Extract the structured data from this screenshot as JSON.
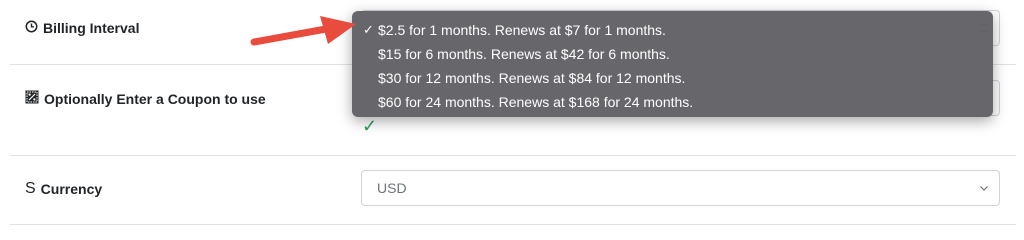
{
  "billing": {
    "label": "Billing Interval",
    "options": [
      "$2.5 for 1 months. Renews at $7 for 1 months.",
      "$15 for 6 months. Renews at $42 for 6 months.",
      "$30 for 12 months. Renews at $84 for 12 months.",
      "$60 for 24 months. Renews at $168 for 24 months."
    ],
    "selected_index": 0,
    "check_glyph": "✓"
  },
  "coupon": {
    "label": "Optionally Enter a Coupon to use",
    "valid_mark": "✓"
  },
  "currency": {
    "label": "Currency",
    "value": "USD",
    "icon_glyph": "S"
  },
  "colors": {
    "annotation_arrow": "#e94b3c",
    "valid_check": "#2e9e5b",
    "dropdown_bg": "#606065"
  }
}
